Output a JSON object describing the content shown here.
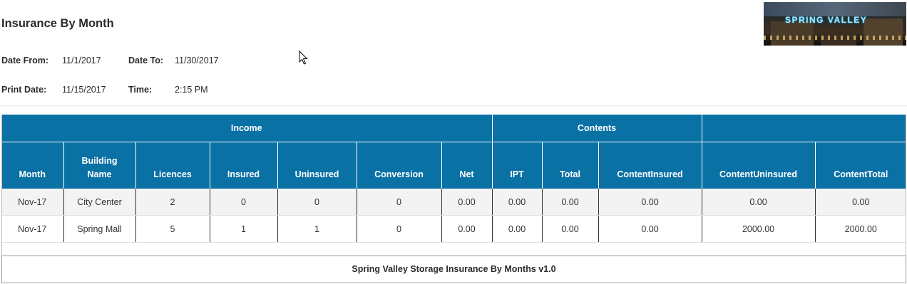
{
  "report": {
    "title": "Insurance By Month",
    "date_from_label": "Date From:",
    "date_from": "11/1/2017",
    "date_to_label": "Date To:",
    "date_to": "11/30/2017",
    "print_date_label": "Print Date:",
    "print_date": "11/15/2017",
    "time_label": "Time:",
    "time": "2:15 PM"
  },
  "logo": {
    "text": "SPRING VALLEY"
  },
  "table": {
    "groups": [
      {
        "label": "Income"
      },
      {
        "label": "Contents"
      },
      {
        "label": ""
      }
    ],
    "columns": [
      "Month",
      "Building Name",
      "Licences",
      "Insured",
      "Uninsured",
      "Conversion",
      "Net",
      "IPT",
      "Total",
      "ContentInsured",
      "ContentUninsured",
      "ContentTotal"
    ],
    "rows": [
      [
        "Nov-17",
        "City Center",
        "2",
        "0",
        "0",
        "0",
        "0.00",
        "0.00",
        "0.00",
        "0.00",
        "0.00",
        "0.00"
      ],
      [
        "Nov-17",
        "Spring Mall",
        "5",
        "1",
        "1",
        "0",
        "0.00",
        "0.00",
        "0.00",
        "0.00",
        "2000.00",
        "2000.00"
      ]
    ]
  },
  "footer": {
    "text": "Spring Valley Storage Insurance By Months v1.0"
  }
}
